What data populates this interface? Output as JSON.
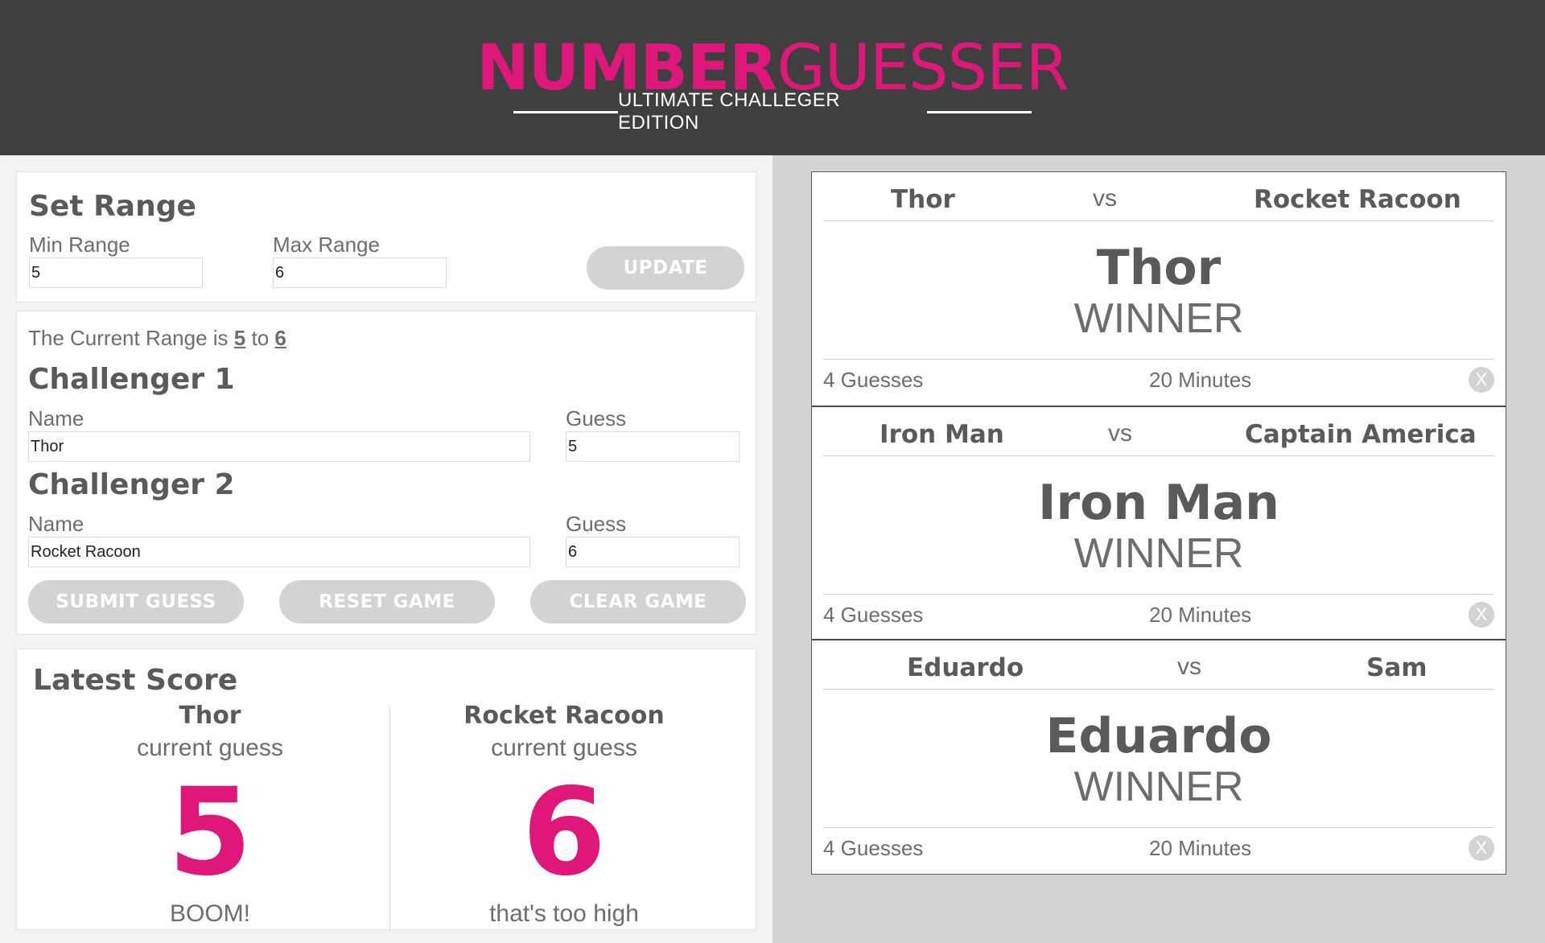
{
  "header": {
    "title_bold": "NUMBER",
    "title_light": "GUESSER",
    "subtitle": "ULTIMATE CHALLEGER EDITION",
    "accent_color": "#e0177a"
  },
  "set_range": {
    "title": "Set Range",
    "min_label": "Min Range",
    "min_value": "5",
    "max_label": "Max Range",
    "max_value": "6",
    "update_button": "UPDATE"
  },
  "current_range": {
    "prefix": "The Current Range is",
    "min": "5",
    "connector": "to",
    "max": "6"
  },
  "challenger1": {
    "title": "Challenger 1",
    "name_label": "Name",
    "name_value": "Thor",
    "guess_label": "Guess",
    "guess_value": "5"
  },
  "challenger2": {
    "title": "Challenger 2",
    "name_label": "Name",
    "name_value": "Rocket Racoon",
    "guess_label": "Guess",
    "guess_value": "6"
  },
  "buttons": {
    "submit": "SUBMIT GUESS",
    "reset": "RESET GAME",
    "clear": "CLEAR GAME"
  },
  "latest_score": {
    "title": "Latest Score",
    "players": [
      {
        "name": "Thor",
        "label": "current guess",
        "guess": "5",
        "status": "BOOM!"
      },
      {
        "name": "Rocket Racoon",
        "label": "current guess",
        "guess": "6",
        "status": "that's too high"
      }
    ]
  },
  "matches": [
    {
      "player1": "Thor",
      "vs": "vs",
      "player2": "Rocket Racoon",
      "winner": "Thor",
      "winner_label": "WINNER",
      "guesses": "4 Guesses",
      "minutes": "20 Minutes",
      "close": "X"
    },
    {
      "player1": "Iron Man",
      "vs": "vs",
      "player2": "Captain America",
      "winner": "Iron Man",
      "winner_label": "WINNER",
      "guesses": "4 Guesses",
      "minutes": "20 Minutes",
      "close": "X"
    },
    {
      "player1": "Eduardo",
      "vs": "vs",
      "player2": "Sam",
      "winner": "Eduardo",
      "winner_label": "WINNER",
      "guesses": "4 Guesses",
      "minutes": "20 Minutes",
      "close": "X"
    }
  ]
}
